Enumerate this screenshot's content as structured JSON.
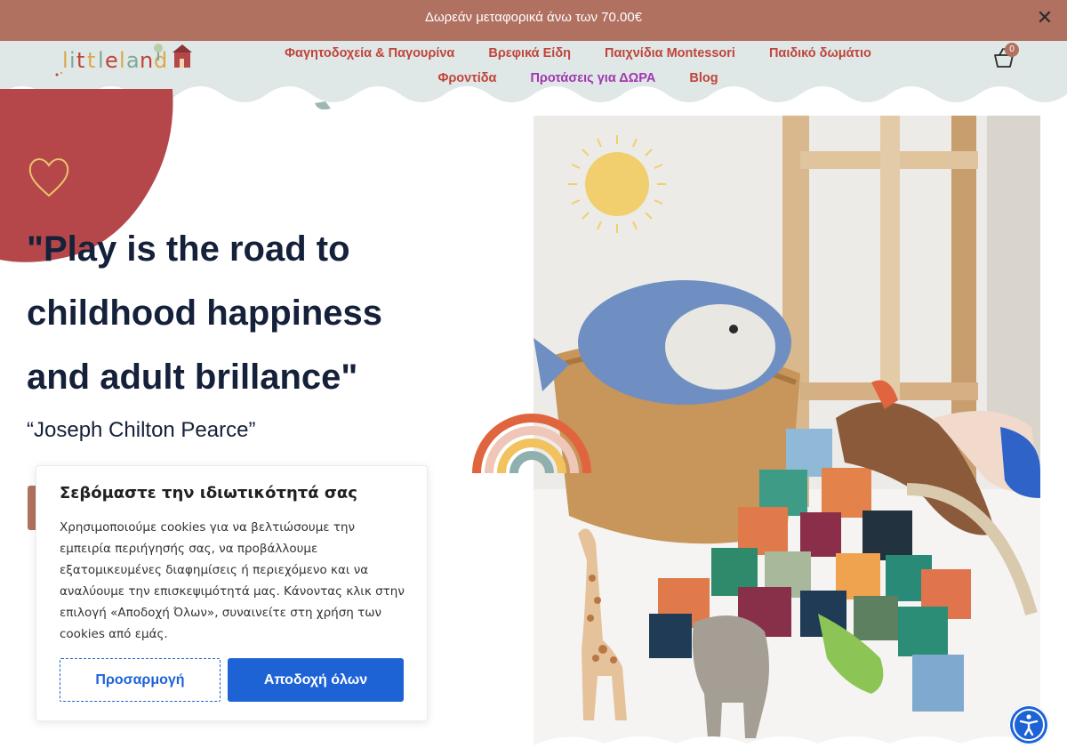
{
  "announcement": {
    "text": "Δωρεάν μεταφορικά άνω των 70.00€",
    "close_icon": "close-icon"
  },
  "logo": {
    "text": "littleland",
    "icon": "house-icon"
  },
  "nav": {
    "row1": [
      {
        "label": "Φαγητοδοχεία & Παγουρίνα",
        "color": "#c0443c"
      },
      {
        "label": "Βρεφικά Είδη",
        "color": "#c0443c"
      },
      {
        "label": "Παιχνίδια Montessori",
        "color": "#c0443c"
      },
      {
        "label": "Παιδικό δωμάτιο",
        "color": "#c0443c"
      }
    ],
    "row2": [
      {
        "label": "Φροντίδα",
        "color": "#c0443c"
      },
      {
        "label": "Προτάσεις για ΔΩΡΑ",
        "color": "#a237b0"
      },
      {
        "label": "Blog",
        "color": "#c0443c"
      }
    ]
  },
  "cart": {
    "icon": "basket-icon",
    "count": "0"
  },
  "hero": {
    "quote_lines": [
      "\"Play is the road to",
      "childhood happiness",
      "and adult brillance\""
    ],
    "author": "“Joseph Chilton Pearce”"
  },
  "cookie_banner": {
    "title": "Σεβόμαστε την ιδιωτικότητά σας",
    "text": "Χρησιμοποιούμε cookies για να βελτιώσουμε την εμπειρία περιήγησής σας, να προβάλλουμε εξατομικευμένες διαφημίσεις ή περιεχόμενο και να αναλύουμε την επισκεψιμότητά μας. Κάνοντας κλικ στην επιλογή «Αποδοχή Όλων», συναινείτε στη χρήση των cookies από εμάς.",
    "customize_label": "Προσαρμογή",
    "accept_label": "Αποδοχή όλων"
  },
  "accessibility": {
    "icon": "accessibility-icon"
  },
  "colors": {
    "announce_bg": "#b07161",
    "header_bg": "#dfe8e6",
    "nav_red": "#c0443c",
    "nav_purple": "#a237b0",
    "blob": "#b5474a",
    "headline": "#15213a",
    "primary_blue": "#1d63d6"
  }
}
